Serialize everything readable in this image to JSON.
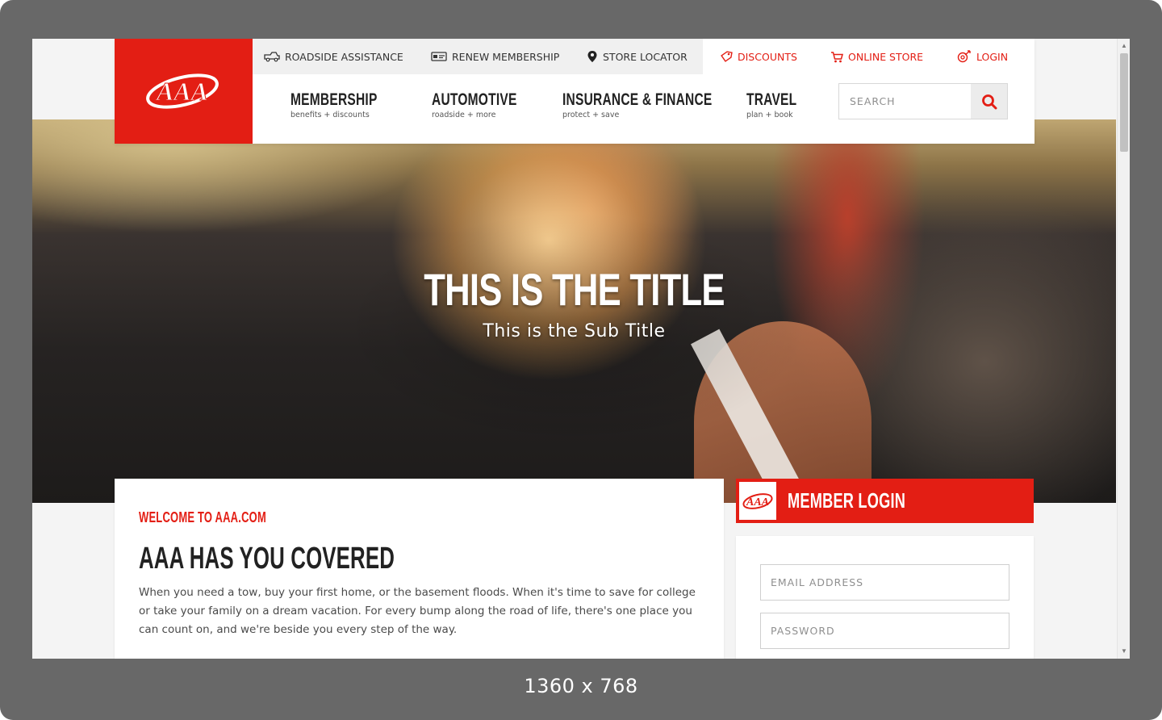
{
  "viewport_label": "1360 x 768",
  "colors": {
    "brand_red": "#e31e14",
    "text_dark": "#222222"
  },
  "header": {
    "logo_alt": "AAA",
    "utility": [
      {
        "label": "ROADSIDE ASSISTANCE",
        "icon": "tow-truck-icon"
      },
      {
        "label": "RENEW MEMBERSHIP",
        "icon": "membership-card-icon"
      },
      {
        "label": "STORE LOCATOR",
        "icon": "map-pin-icon"
      },
      {
        "label": "DISCOUNTS",
        "icon": "tag-icon"
      },
      {
        "label": "ONLINE STORE",
        "icon": "shopping-cart-icon"
      },
      {
        "label": "LOGIN",
        "icon": "login-icon"
      }
    ],
    "nav": [
      {
        "label": "MEMBERSHIP",
        "sub": "benefits + discounts"
      },
      {
        "label": "AUTOMOTIVE",
        "sub": "roadside + more"
      },
      {
        "label": "INSURANCE & FINANCE",
        "sub": "protect + save"
      },
      {
        "label": "TRAVEL",
        "sub": "plan + book"
      }
    ],
    "search": {
      "placeholder": "SEARCH",
      "icon": "search-icon"
    }
  },
  "hero": {
    "title": "THIS IS THE TITLE",
    "subtitle": "This is the Sub Title"
  },
  "welcome": {
    "eyebrow": "WELCOME TO AAA.COM",
    "heading": "AAA HAS YOU COVERED",
    "body": "When you need a tow, buy your first home, or the basement floods. When it's time to save for college or take your family on a dream vacation. For every bump along the road of life, there's one place you can count on, and we're beside you every step of the way."
  },
  "member_login": {
    "title": "MEMBER LOGIN",
    "email_placeholder": "EMAIL ADDRESS",
    "password_placeholder": "PASSWORD"
  }
}
